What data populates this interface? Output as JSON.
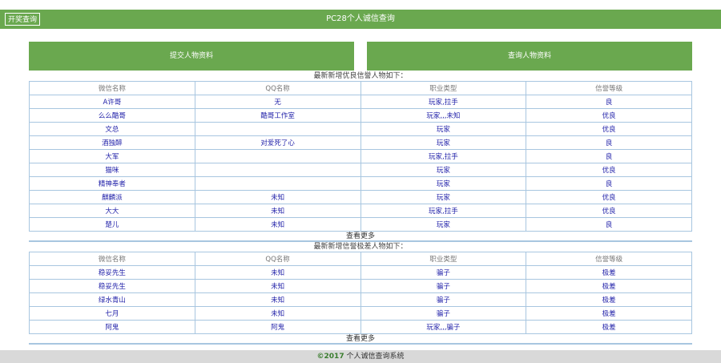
{
  "header": {
    "lottery_button": "开奖查询",
    "title": "PC28个人诚信查询"
  },
  "actions": {
    "submit_label": "提交人物资料",
    "query_label": "查询人物资料"
  },
  "columns": [
    "微信名称",
    "QQ名称",
    "职业类型",
    "信誉等级"
  ],
  "good": {
    "title": "最新新增优良信誉人物如下：",
    "more": "查看更多",
    "rows": [
      [
        "A许哥",
        "无",
        "玩家,拉手",
        "良"
      ],
      [
        "么么酷哥",
        "酷哥工作室",
        "玩家,,,未知",
        "优良"
      ],
      [
        "文总",
        "",
        "玩家",
        "优良"
      ],
      [
        "酒独醉",
        "对爱死了心",
        "玩家",
        "良"
      ],
      [
        "大军",
        "",
        "玩家,拉手",
        "良"
      ],
      [
        "猫咪",
        "",
        "玩家",
        "优良"
      ],
      [
        "精神奉者",
        "",
        "玩家",
        "良"
      ],
      [
        "麒麟派",
        "未知",
        "玩家",
        "优良"
      ],
      [
        "大大",
        "未知",
        "玩家,拉手",
        "优良"
      ],
      [
        "楚儿",
        "未知",
        "玩家",
        "良"
      ]
    ]
  },
  "bad": {
    "title": "最新新增信誉极差人物如下：",
    "more": "查看更多",
    "rows": [
      [
        "稳妥先生",
        "未知",
        "骗子",
        "极差"
      ],
      [
        "稳妥先生",
        "未知",
        "骗子",
        "极差"
      ],
      [
        "绿水青山",
        "未知",
        "骗子",
        "极差"
      ],
      [
        "七月",
        "未知",
        "骗子",
        "极差"
      ],
      [
        "阿鬼",
        "阿鬼",
        "玩家,,,骗子",
        "极差"
      ]
    ]
  },
  "footer": {
    "year": "©2017",
    "text": " 个人诚信查询系统"
  }
}
